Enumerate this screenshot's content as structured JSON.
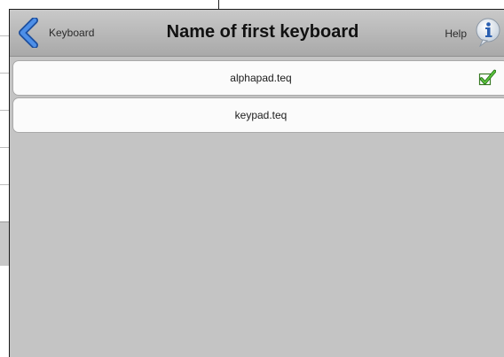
{
  "header": {
    "back_label": "Keyboard",
    "title": "Name of first keyboard",
    "help_label": "Help"
  },
  "keyboards": [
    {
      "name": "alphapad.teq",
      "selected": true
    },
    {
      "name": "keypad.teq",
      "selected": false
    }
  ],
  "colors": {
    "accent_blue": "#2f6fd6",
    "check_green": "#3a9a26"
  }
}
